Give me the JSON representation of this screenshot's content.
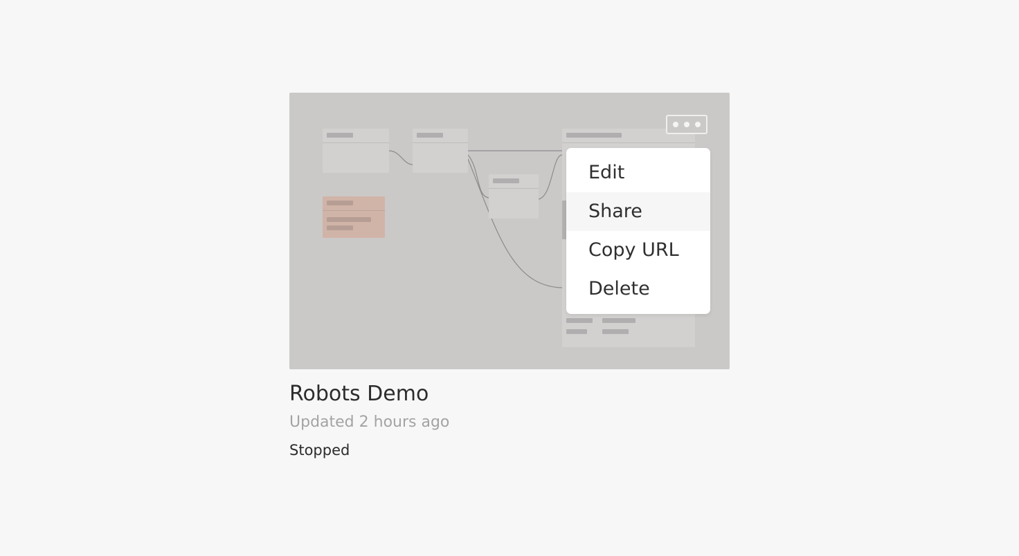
{
  "card": {
    "title": "Robots Demo",
    "updated": "Updated 2 hours ago",
    "status": "Stopped"
  },
  "menu": {
    "items": [
      {
        "label": "Edit"
      },
      {
        "label": "Share"
      },
      {
        "label": "Copy URL"
      },
      {
        "label": "Delete"
      }
    ],
    "hovered": "Share"
  },
  "colors": {
    "background": "#f7f7f7",
    "preview": "#cbc9c8",
    "menu": "#ffffff",
    "accent_node": "#d1b4a8"
  },
  "icons": {
    "more": "more-horizontal-icon"
  }
}
